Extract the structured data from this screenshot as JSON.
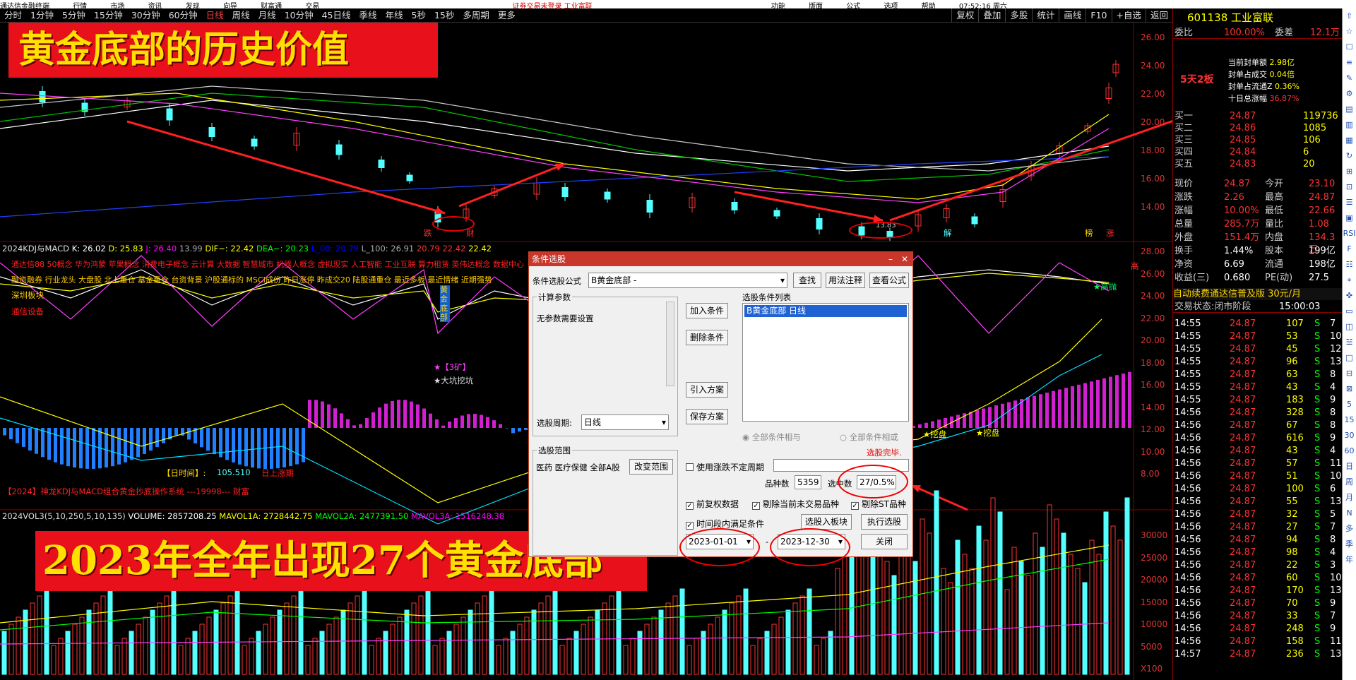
{
  "topbar": {
    "left": "通达信金融终端",
    "menu1": "行情",
    "menu2": "市场",
    "menu3": "资讯",
    "menu4": "发现",
    "menu5": "向导",
    "menu6": "财富通",
    "menu7": "交易",
    "center": "证券交易未登录 工业富联",
    "r1": "功能",
    "r2": "版面",
    "r3": "公式",
    "r4": "选项",
    "r5": "帮助",
    "time": "07:52:16 周六"
  },
  "toolbar": {
    "items": [
      "分时",
      "1分钟",
      "5分钟",
      "15分钟",
      "30分钟",
      "60分钟",
      "日线",
      "周线",
      "月线",
      "10分钟",
      "45日线",
      "季线",
      "年线",
      "5秒",
      "15秒",
      "多周期",
      "更多"
    ],
    "selected": "日线",
    "right": [
      "复权",
      "叠加",
      "多股",
      "统计",
      "画线",
      "F10",
      "+自选",
      "返回"
    ]
  },
  "banners": {
    "top": "黄金底部的历史价值",
    "bottom": "2023年全年出现27个黄金底部"
  },
  "price_axis": [
    "26.00",
    "24.00",
    "22.00",
    "20.00",
    "18.00",
    "16.00",
    "14.00"
  ],
  "markers": {
    "die": "跌",
    "cai": "财",
    "jie": "解",
    "bang": "榜",
    "zhang": "涨",
    "low": "13.83"
  },
  "kdj_header": {
    "name": "2024KDJ与MACD",
    "k": "K: 26.02",
    "d": "D: 25.83",
    "j": "J: 26.40",
    "j2": "13.99",
    "dif": "DIF~: 22.42",
    "dea": "DEA~: 20.23",
    "l00": "L_00: 20.79",
    "l100": "L_100: 26.91",
    "v1": "20.79",
    "v2": "22.42",
    "v3": "22.42"
  },
  "concepts": {
    "line1": "通达信88 50概念 华为鸿蒙 苹果概念 消费电子概念 云计算 大数据 智慧城市 机器人概念 虚拟现实 人工智能 工业互联 算力租赁 英伟达概念 数据中心",
    "line2": "融资融券 行业龙头 大盘股 北上重仓 基金重仓 台资背景 沪股通标的 MSCI成份 昨日涨停 昨成交20 陆股通重仓 最近多板 最近情绪 近期强势",
    "line3": "深圳板块",
    "line4": "通信设备"
  },
  "kdj_axis": [
    "28.00",
    "26.00",
    "24.00",
    "22.00",
    "20.00",
    "18.00",
    "16.00",
    "14.00",
    "12.00",
    "10.00",
    "8.00"
  ],
  "kdj_notes": {
    "gold": "黄金底部",
    "kuang": "★【3矿】",
    "keng": "★大坑挖坑",
    "time_label": "【日时间】:",
    "time_val": "105.510",
    "dir": "日上涨期",
    "footer": "【2024】神龙KDJ与MACD组合黄金抄底操作系统 ---19998--- 财富",
    "wa1": "★挖盘",
    "wa2": "★挖盘",
    "gao": "★高抛",
    "gaoR": "高"
  },
  "vol_header": {
    "name": "2024VOL3(5,10,250,5,10,135)",
    "vol": "VOLUME: 2857208.25",
    "ma1": "MAVOL1A: 2728442.75",
    "ma2": "MAVOL2A: 2477391.50",
    "ma3": "MAVOL3A: 1516248.38"
  },
  "vol_axis": [
    "30000",
    "25000",
    "20000",
    "15000",
    "10000",
    "5000",
    "X100"
  ],
  "stock": {
    "code": "601138",
    "name": "工业富联",
    "wb_label": "委比",
    "wb": "100.00%",
    "wc_label": "委差",
    "wc": "12.1万",
    "badge": "5天2板",
    "f1": "当前封单额",
    "f1v": "2.98亿",
    "f2": "封单占成交",
    "f2v": "0.04倍",
    "f3": "封单占流通Z",
    "f3v": "0.36%",
    "f4": "十日总涨幅",
    "f4v": "36.87%"
  },
  "bids": [
    [
      "买一",
      "24.87",
      "119736"
    ],
    [
      "买二",
      "24.86",
      "1085"
    ],
    [
      "买三",
      "24.85",
      "106"
    ],
    [
      "买四",
      "24.84",
      "6"
    ],
    [
      "买五",
      "24.83",
      "20"
    ]
  ],
  "quote": [
    [
      "现价",
      "24.87",
      "今开",
      "23.10"
    ],
    [
      "涨跌",
      "2.26",
      "最高",
      "24.87"
    ],
    [
      "涨幅",
      "10.00%",
      "最低",
      "22.66"
    ],
    [
      "总量",
      "285.7万",
      "量比",
      "1.08"
    ],
    [
      "外盘",
      "151.4万",
      "内盘",
      "134.3万"
    ],
    [
      "换手",
      "1.44%",
      "股本",
      "199亿"
    ],
    [
      "净资",
      "6.69",
      "流通",
      "198亿"
    ],
    [
      "收益(三)",
      "0.680",
      "PE(动)",
      "27.5"
    ]
  ],
  "ad": "自动续费通达信普及版 30元/月",
  "status": {
    "label": "交易状态:",
    "value": "闭市阶段",
    "time": "15:00:03"
  },
  "ticks": [
    [
      "14:55",
      "24.87",
      "107",
      "S",
      "7"
    ],
    [
      "14:55",
      "24.87",
      "53",
      "S",
      "10"
    ],
    [
      "14:55",
      "24.87",
      "45",
      "S",
      "12"
    ],
    [
      "14:55",
      "24.87",
      "96",
      "S",
      "13"
    ],
    [
      "14:55",
      "24.87",
      "63",
      "S",
      "8"
    ],
    [
      "14:55",
      "24.87",
      "43",
      "S",
      "4"
    ],
    [
      "14:55",
      "24.87",
      "183",
      "S",
      "9"
    ],
    [
      "14:56",
      "24.87",
      "328",
      "S",
      "8"
    ],
    [
      "14:56",
      "24.87",
      "67",
      "S",
      "8"
    ],
    [
      "14:56",
      "24.87",
      "616",
      "S",
      "9"
    ],
    [
      "14:56",
      "24.87",
      "43",
      "S",
      "4"
    ],
    [
      "14:56",
      "24.87",
      "57",
      "S",
      "11"
    ],
    [
      "14:56",
      "24.87",
      "51",
      "S",
      "10"
    ],
    [
      "14:56",
      "24.87",
      "100",
      "S",
      "6"
    ],
    [
      "14:56",
      "24.87",
      "55",
      "S",
      "13"
    ],
    [
      "14:56",
      "24.87",
      "32",
      "S",
      "5"
    ],
    [
      "14:56",
      "24.87",
      "27",
      "S",
      "7"
    ],
    [
      "14:56",
      "24.87",
      "94",
      "S",
      "8"
    ],
    [
      "14:56",
      "24.87",
      "98",
      "S",
      "4"
    ],
    [
      "14:56",
      "24.87",
      "22",
      "S",
      "3"
    ],
    [
      "14:56",
      "24.87",
      "60",
      "S",
      "10"
    ],
    [
      "14:56",
      "24.87",
      "170",
      "S",
      "13"
    ],
    [
      "14:56",
      "24.87",
      "70",
      "S",
      "9"
    ],
    [
      "14:56",
      "24.87",
      "33",
      "S",
      "7"
    ],
    [
      "14:56",
      "24.87",
      "248",
      "S",
      "9"
    ],
    [
      "14:56",
      "24.87",
      "158",
      "S",
      "11"
    ],
    [
      "14:57",
      "24.87",
      "236",
      "S",
      "13"
    ]
  ],
  "sidetools": [
    "⇧",
    "☆",
    "☐",
    "≡",
    "✎",
    "⚙",
    "▤",
    "▥",
    "▦",
    "↻",
    "⊞",
    "⊡",
    "☰",
    "▣",
    "RSI",
    "F",
    "☷",
    "⌖",
    "✜",
    "▭",
    "◫",
    "☱",
    "□",
    "⊟",
    "⊠",
    "5",
    "15",
    "30",
    "60",
    "日",
    "周",
    "月",
    "N",
    "多",
    "季",
    "年"
  ],
  "dialog": {
    "title": "条件选股",
    "formula_label": "条件选股公式",
    "formula": "B黄金底部 -",
    "btn_query": "查找",
    "btn_usage": "用法注释",
    "btn_view": "查看公式",
    "params_title": "计算参数",
    "params_text": "无参数需要设置",
    "period_label": "选股周期:",
    "period": "日线",
    "btn_add": "加入条件",
    "btn_del": "删除条件",
    "btn_import": "引入方案",
    "btn_save": "保存方案",
    "list_title": "选股条件列表",
    "list_item": "B黄金底部  日线",
    "radio1": "全部条件相与",
    "radio2": "全部条件相或",
    "range_title": "选股范围",
    "range_text": "医药 医疗保健 全部A股",
    "btn_range": "改变范围",
    "done": "选股完毕.",
    "cb_period": "使用涨跌不定周期",
    "count_label": "品种数",
    "count": "5359",
    "sel_label": "选中数",
    "sel": "27/0.5%",
    "cb1": "前复权数据",
    "cb2": "剔除当前未交易品种",
    "cb3": "剔除ST品种",
    "cb4": "时间段内满足条件",
    "btn_block": "选股入板块",
    "btn_exec": "执行选股",
    "date_from": "2023-01-01",
    "date_sep": "-",
    "date_to": "2023-12-30",
    "btn_close": "关闭"
  },
  "colors": {
    "up": "#ff3232",
    "down": "#54ffff",
    "panel_border": "#800000",
    "accent": "#ffe000"
  }
}
